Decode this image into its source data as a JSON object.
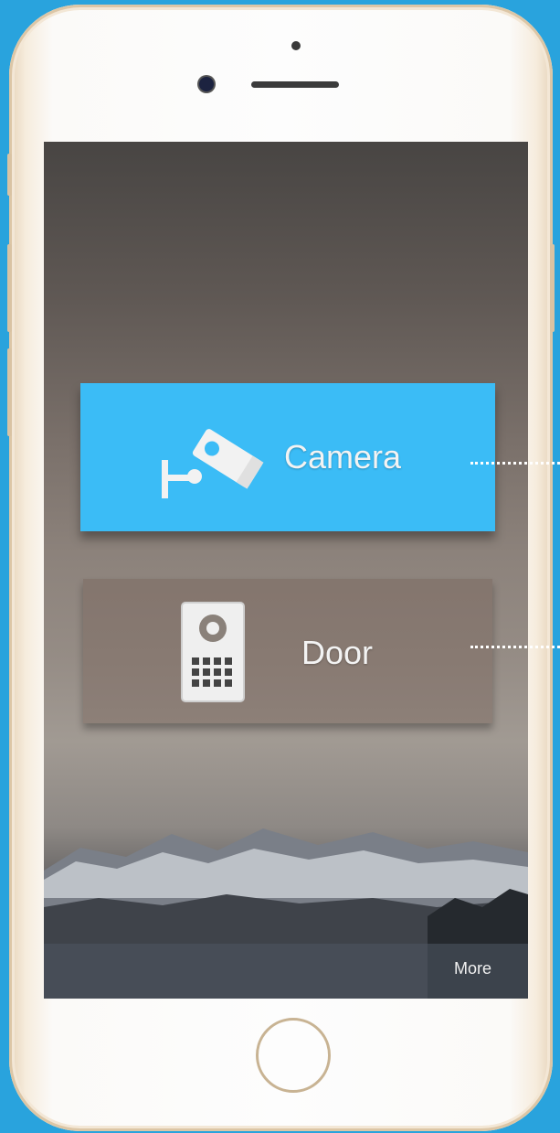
{
  "tiles": [
    {
      "label": "Camera",
      "icon": "security-camera-icon",
      "color": "#3bbcf6"
    },
    {
      "label": "Door",
      "icon": "door-intercom-icon"
    }
  ],
  "footer": {
    "more_label": "More"
  },
  "colors": {
    "background": "#29a3dd",
    "accent": "#3bbcf6"
  }
}
